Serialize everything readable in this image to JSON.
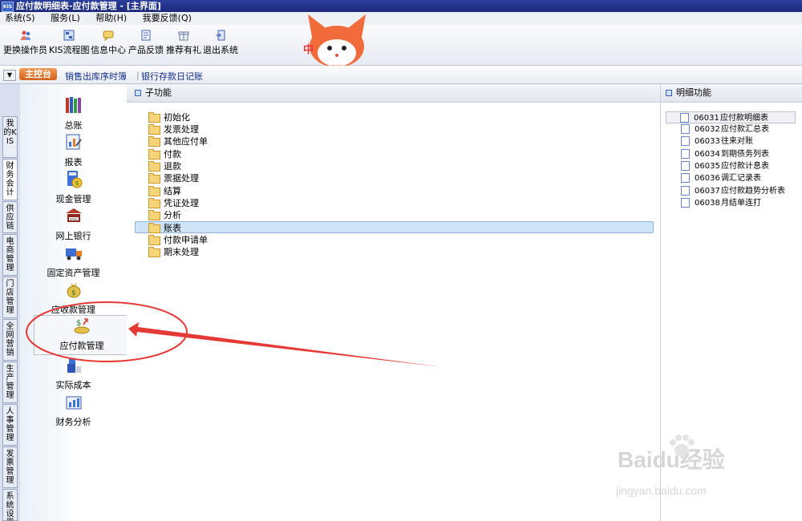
{
  "window": {
    "title": "应付款明细表-应付款管理 - [主界面]",
    "app_icon_text": "KIS"
  },
  "menu": [
    "系统(S)",
    "服务(L)",
    "帮助(H)",
    "我要反馈(Q)"
  ],
  "toolbar": [
    {
      "label": "更换操作员",
      "icon": "users-icon"
    },
    {
      "label": "KIS流程图",
      "icon": "flowchart-icon"
    },
    {
      "label": "信息中心",
      "icon": "message-icon"
    },
    {
      "label": "产品反馈",
      "icon": "feedback-icon"
    },
    {
      "label": "推荐有礼",
      "icon": "gift-icon"
    },
    {
      "label": "退出系统",
      "icon": "exit-icon"
    }
  ],
  "mascot_text": "中",
  "nav": {
    "home": "主控台",
    "links": [
      "销售出库序时簿",
      "银行存款日记账"
    ]
  },
  "side_tabs": [
    "我的KIS",
    "财务会计",
    "供应链",
    "电商管理",
    "门店管理",
    "全网营销",
    "生产管理",
    "人事管理",
    "发票管理",
    "系统设置"
  ],
  "modules": [
    "总账",
    "报表",
    "现金管理",
    "网上银行",
    "固定资产管理",
    "应收款管理",
    "应付款管理",
    "实际成本",
    "财务分析"
  ],
  "selected_module": "应付款管理",
  "sub": {
    "title": "子功能",
    "items": [
      "初始化",
      "发票处理",
      "其他应付单",
      "付款",
      "退款",
      "票据处理",
      "结算",
      "凭证处理",
      "分析",
      "账表",
      "付款申请单",
      "期末处理"
    ],
    "selected": "账表"
  },
  "detail": {
    "title": "明细功能",
    "items": [
      {
        "code": "06031",
        "label": "应付款明细表"
      },
      {
        "code": "06032",
        "label": "应付款汇总表"
      },
      {
        "code": "06033",
        "label": "往来对账"
      },
      {
        "code": "06034",
        "label": "到期债务列表"
      },
      {
        "code": "06035",
        "label": "应付款计息表"
      },
      {
        "code": "06036",
        "label": "调汇记录表"
      },
      {
        "code": "06037",
        "label": "应付款趋势分析表"
      },
      {
        "code": "06038",
        "label": "月结单连打"
      }
    ]
  },
  "watermark": {
    "brand": "Baidu经验",
    "url": "jingyan.baidu.com"
  },
  "colors": {
    "titlebar": "#1b2a7a",
    "home_button": "#d2621c",
    "selection": "#cfe3f6",
    "annotation": "#e53935"
  }
}
